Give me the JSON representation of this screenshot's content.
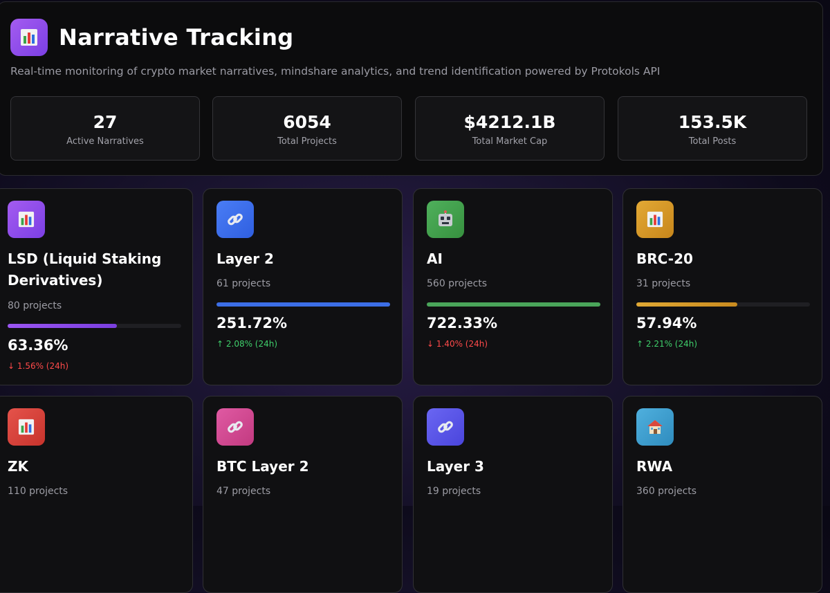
{
  "header": {
    "title": "Narrative Tracking",
    "subtitle": "Real-time monitoring of crypto market narratives, mindshare analytics, and trend identification powered by Protokols API",
    "icon": "bar-chart-icon",
    "accent": "#8b47ea"
  },
  "stats": [
    {
      "value": "27",
      "label": "Active Narratives"
    },
    {
      "value": "6054",
      "label": "Total Projects"
    },
    {
      "value": "$4212.1B",
      "label": "Total Market Cap"
    },
    {
      "value": "153.5K",
      "label": "Total Posts"
    }
  ],
  "cards": [
    {
      "name": "LSD (Liquid Staking Derivatives)",
      "projects": "80 projects",
      "percent": "63.36%",
      "change": "↓ 1.56% (24h)",
      "direction": "down",
      "progress": 0.63,
      "icon": "bar-chart-icon",
      "color": "#8b47ea",
      "bar_color": "#8d4bf0"
    },
    {
      "name": "Layer 2",
      "projects": "61 projects",
      "percent": "251.72%",
      "change": "↑ 2.08% (24h)",
      "direction": "up",
      "progress": 1.0,
      "icon": "link-icon",
      "color": "#3f6ff0",
      "bar_color": "#3c6ee6"
    },
    {
      "name": "AI",
      "projects": "560 projects",
      "percent": "722.33%",
      "change": "↓ 1.40% (24h)",
      "direction": "down",
      "progress": 1.0,
      "icon": "robot-icon",
      "color": "#3e9e4b",
      "bar_color": "#4aa55a"
    },
    {
      "name": "BRC-20",
      "projects": "31 projects",
      "percent": "57.94%",
      "change": "↑ 2.21% (24h)",
      "direction": "up",
      "progress": 0.58,
      "icon": "bar-chart-icon",
      "color": "#d89a26",
      "bar_color": "#d49a30"
    },
    {
      "name": "ZK",
      "projects": "110 projects",
      "icon": "bar-chart-icon",
      "color": "#d8403a"
    },
    {
      "name": "BTC Layer 2",
      "projects": "47 projects",
      "icon": "link-icon",
      "color": "#d44a92"
    },
    {
      "name": "Layer 3",
      "projects": "19 projects",
      "icon": "link-icon",
      "color": "#5b57e8"
    },
    {
      "name": "RWA",
      "projects": "360 projects",
      "icon": "house-icon",
      "color": "#3f9ccc"
    }
  ]
}
